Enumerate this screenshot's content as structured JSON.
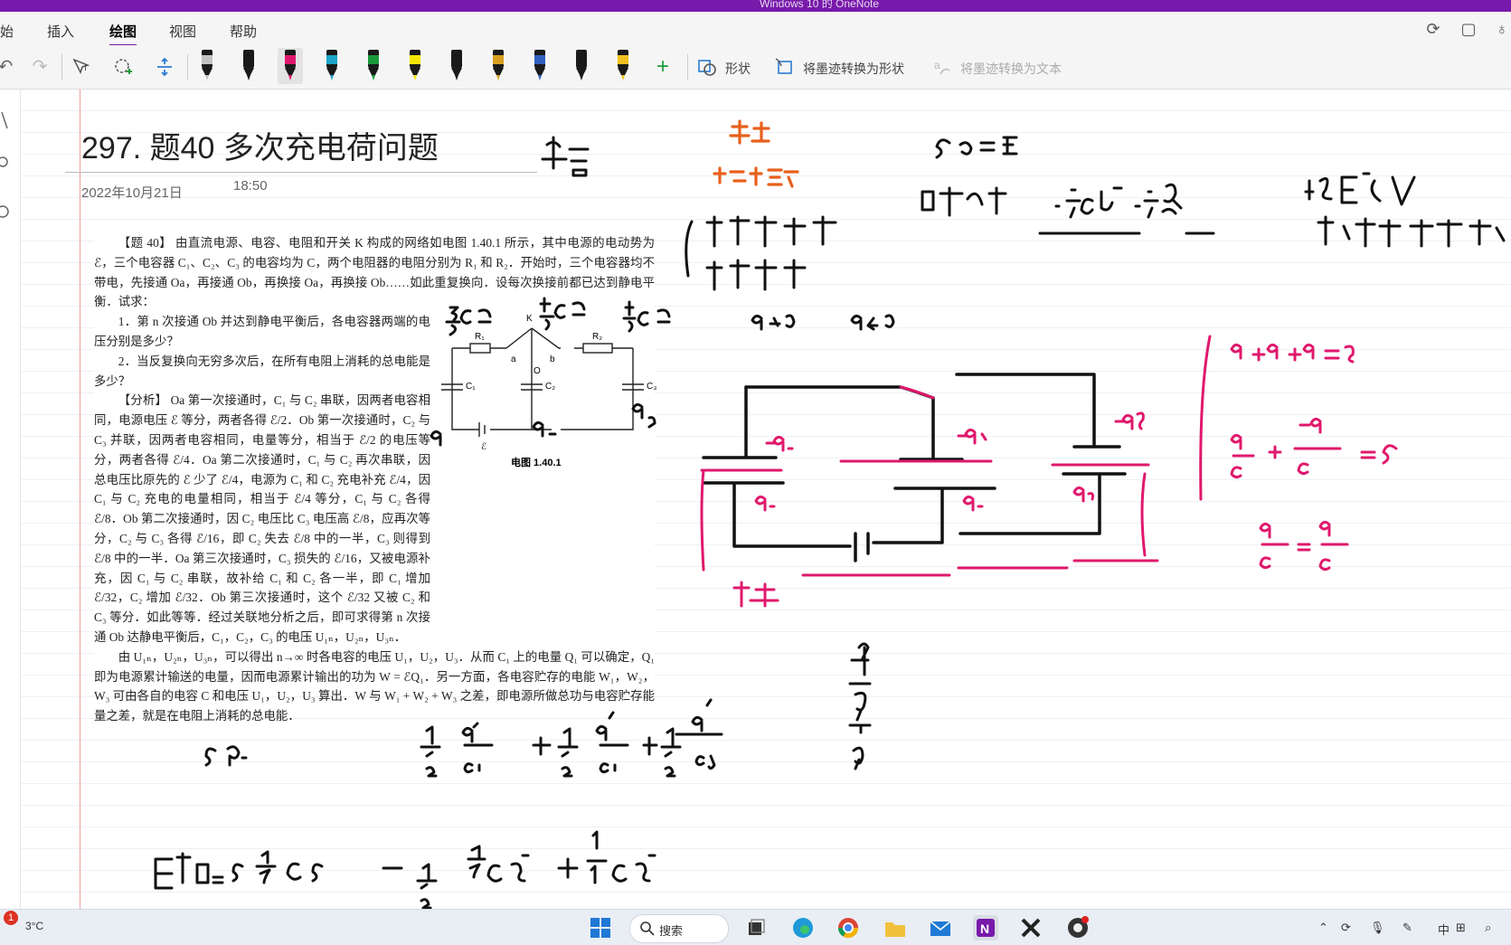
{
  "window": {
    "title": "Windows 10 的 OneNote"
  },
  "ribbon": {
    "tabs": [
      {
        "label": "始"
      },
      {
        "label": "插入"
      },
      {
        "label": "绘图"
      },
      {
        "label": "视图"
      },
      {
        "label": "帮助"
      }
    ],
    "active_tab": "绘图",
    "tools": {
      "shapes_label": "形状",
      "ink_to_shape_label": "将墨迹转换为形状",
      "ink_to_text_label": "将墨迹转换为文本"
    },
    "pen_colors": [
      "#c2c2c2",
      "#1a1a1a",
      "#e0186c",
      "#1aa4c8",
      "#1a9a3a",
      "#f2e600",
      "#1a1a1a",
      "#d8a020",
      "#3060c0",
      "#1a1a1a",
      "#f0c020"
    ]
  },
  "page": {
    "title": "297.  题40 多次充电荷问题",
    "date": "2022年10月21日",
    "time": "18:50"
  },
  "scan": {
    "paragraphs": [
      "【题 40】 由直流电源、电容、电阻和开关 K 构成的网络如电图 1.40.1 所示，其中电源的电动势为 ℰ，三个电容器 C₁、C₂、C₃ 的电容均为 C，两个电阻器的电阻分别为 R₁ 和 R₂．开始时，三个电容器均不带电，先接通 Oa，再接通 Ob，再换接 Oa，再换接 Ob……如此重复换向．设每次换接前都已达到静电平衡．试求：",
      "1．第 n 次接通 Ob 并达到静电平衡后，各电容器两端的电压分别是多少？",
      "2．当反复换向无穷多次后，在所有电阻上消耗的总电能是多少？",
      "【分析】 Oa 第一次接通时，C₁ 与 C₂ 串联，因两者电容相同，电源电压 ℰ 等分，两者各得 ℰ/2．Ob 第一次接通时，C₂ 与 C₃ 并联，因两者电容相同，电量等分，相当于 ℰ/2 的电压等分，两者各得 ℰ/4．Oa 第二次接通时，C₁ 与 C₂ 再次串联，因总电压比原先的 ℰ 少了 ℰ/4，电源为 C₁ 和 C₂ 充电补充 ℰ/4，因 C₁ 与 C₂ 充电的电量相同，相当于 ℰ/4 等分，C₁ 与 C₂ 各得 ℰ/8．Ob 第二次接通时，因 C₂ 电压比 C₃ 电压高 ℰ/8，应再次等分，C₂ 与 C₃ 各得 ℰ/16，即 C₂ 失去 ℰ/8 中的一半，C₃ 则得到 ℰ/8 中的一半．Oa 第三次接通时，C₃ 损失的 ℰ/16，又被电源补充，因 C₁ 与 C₂ 串联，故补给 C₁ 和 C₂ 各一半，即 C₁ 增加 ℰ/32，C₂ 增加 ℰ/32．Ob 第三次接通时，这个 ℰ/32 又被 C₂ 和 C₃ 等分．如此等等．经过关联地分析之后，即可求得第 n 次接通 Ob 达静电平衡后，C₁，C₂，C₃ 的电压 U₁ₙ，U₂ₙ，U₃ₙ．",
      "由 U₁ₙ，U₂ₙ，U₃ₙ，可以得出 n→∞ 时各电容的电压 U₁，U₂，U₃．从而 C₁ 上的电量 Q₁ 可以确定，Q₁ 即为电源累计输送的电量，因而电源累计输出的功为 W = ℰQ₁．另一方面，各电容贮存的电能 W₁，W₂，W₃ 可由各自的电容 C 和电压 U₁，U₂，U₃ 算出．W 与 W₁ + W₂ + W₃ 之差，即电源所做总功与电容贮存能量之差，就是在电阻上消耗的总电能．"
    ],
    "circuit": {
      "labels": [
        "R₁",
        "K",
        "R₂",
        "a",
        "b",
        "O",
        "C₁",
        "C₂",
        "C₃",
        "ℰ"
      ],
      "caption": "电图 1.40.1"
    }
  },
  "taskbar": {
    "weather": "3°C",
    "badge": "1",
    "search_label": "搜索",
    "tray_ime": "中"
  }
}
